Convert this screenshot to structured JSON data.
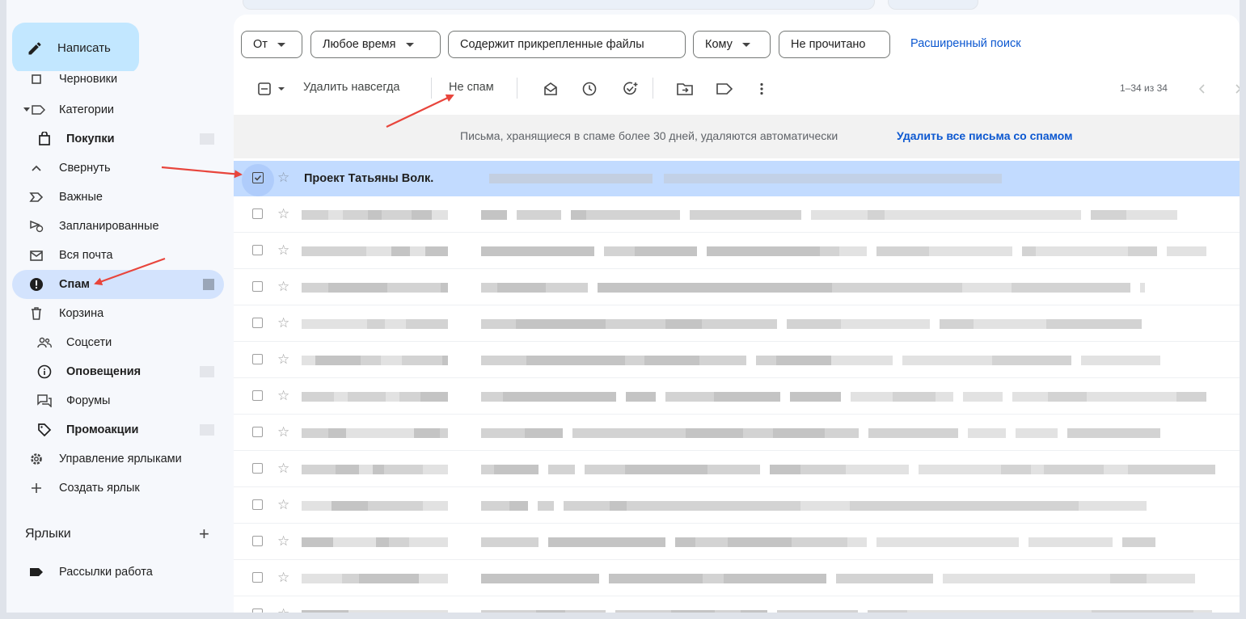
{
  "compose": {
    "label": "Написать"
  },
  "sidebar": {
    "items": [
      {
        "label": "Черновики"
      },
      {
        "label": "Категории"
      },
      {
        "label": "Покупки"
      },
      {
        "label": "Свернуть"
      },
      {
        "label": "Важные"
      },
      {
        "label": "Запланированные"
      },
      {
        "label": "Вся почта"
      },
      {
        "label": "Спам"
      },
      {
        "label": "Корзина"
      },
      {
        "label": "Соцсети"
      },
      {
        "label": "Оповещения"
      },
      {
        "label": "Форумы"
      },
      {
        "label": "Промоакции"
      },
      {
        "label": "Управление ярлыками"
      },
      {
        "label": "Создать ярлык"
      }
    ],
    "labels_heading": "Ярлыки",
    "labels_add": "+",
    "user_labels": [
      {
        "label": "Рассылки работа"
      }
    ]
  },
  "filters": {
    "from": "От",
    "any_time": "Любое время",
    "has_attachments": "Содержит прикрепленные файлы",
    "to": "Кому",
    "unread": "Не прочитано",
    "advanced": "Расширенный поиск"
  },
  "toolbar": {
    "delete_forever": "Удалить навсегда",
    "not_spam": "Не спам",
    "pager": "1–34 из 34"
  },
  "banner": {
    "message": "Письма, хранящиеся в спаме более 30 дней, удаляются автоматически",
    "delete_all": "Удалить все письма со спамом"
  },
  "emails": {
    "selected_sender": "Проект Татьяны Волк."
  },
  "colors": {
    "accent": "#0b57d0",
    "compose_bg": "#c2e7ff",
    "active_nav": "#d3e3fd",
    "selected_row": "#c2dbff",
    "annotation_arrow": "#e8453c"
  }
}
